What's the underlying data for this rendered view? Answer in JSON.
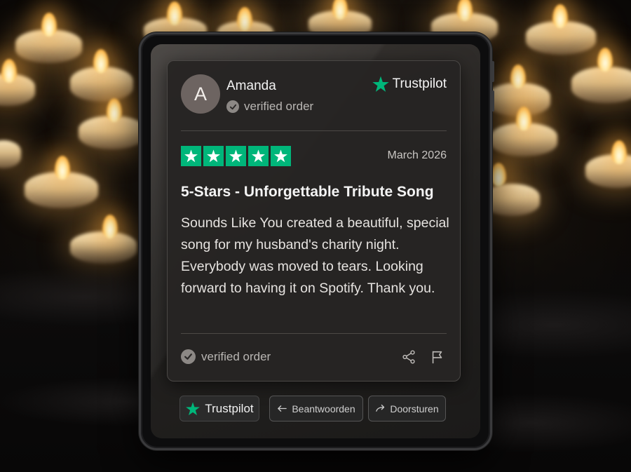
{
  "review": {
    "author_name": "Amanda",
    "avatar_initial": "A",
    "verified_label_top": "verified order",
    "platform_name": "Trustpilot",
    "rating": 5,
    "rating_max": 5,
    "date": "March 2026",
    "title": "5-Stars - Unforgettable Tribute Song",
    "body": "Sounds Like You created a beautiful, special song for my husband's charity night. Everybody was moved to tears. Looking forward to having it on Spotify. Thank you.",
    "verified_label_bottom": "verified order",
    "share_icon": "share-icon",
    "flag_icon": "flag-icon"
  },
  "actions": {
    "trustpilot_label": "Trustpilot",
    "reply_label": "Beantwoorden",
    "forward_label": "Doorsturen"
  },
  "colors": {
    "trustpilot_green": "#00b67a",
    "card_bg": "#262423",
    "text_primary": "#f2f2f2",
    "text_secondary": "#b9b6b3"
  }
}
